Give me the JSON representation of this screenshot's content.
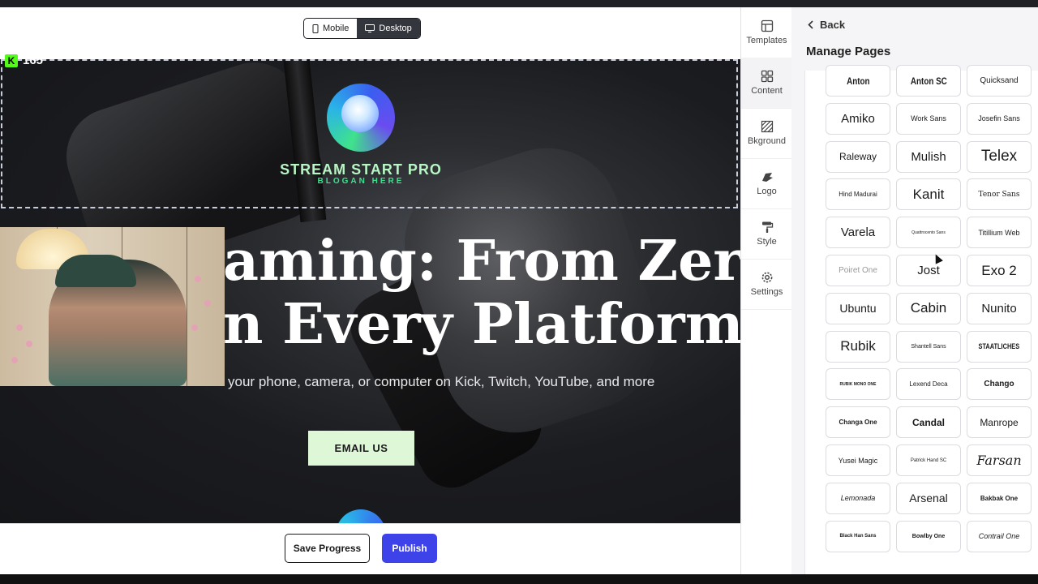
{
  "toolbar": {
    "mobile_label": "Mobile",
    "desktop_label": "Desktop"
  },
  "kick": {
    "count": "165"
  },
  "hero": {
    "brand": "STREAM START PRO",
    "slogan": "BLOGAN HERE",
    "title_line1": "aming: From Zero",
    "title_line2": "n Every Platform.",
    "subtitle": "Learn how to stream from your phone, camera, or computer on Kick, Twitch, YouTube, and more",
    "cta": "EMAIL US"
  },
  "actions": {
    "save": "Save Progress",
    "publish": "Publish"
  },
  "rail": {
    "items": [
      {
        "label": "Templates",
        "icon": "templates-icon"
      },
      {
        "label": "Content",
        "icon": "content-icon"
      },
      {
        "label": "Bkground",
        "icon": "background-icon"
      },
      {
        "label": "Logo",
        "icon": "logo-icon"
      },
      {
        "label": "Style",
        "icon": "style-icon"
      },
      {
        "label": "Settings",
        "icon": "settings-icon"
      }
    ]
  },
  "panel": {
    "back": "Back",
    "title": "Manage Pages"
  },
  "fonts": [
    "Anton",
    "Anton SC",
    "Quicksand",
    "Amiko",
    "Work Sans",
    "Josefin Sans",
    "Raleway",
    "Mulish",
    "Telex",
    "Hind Madurai",
    "Kanit",
    "Tenor Sans",
    "Varela",
    "Quattrocento Sans",
    "Titillium Web",
    "Poiret One",
    "Jost",
    "Exo 2",
    "Ubuntu",
    "Cabin",
    "Nunito",
    "Rubik",
    "Shantell Sans",
    "STAATLICHES",
    "RUBIK MONO ONE",
    "Lexend Deca",
    "Chango",
    "Changa One",
    "Candal",
    "Manrope",
    "Yusei Magic",
    "Patrick Hand SC",
    "Farsan",
    "Lemonada",
    "Arsenal",
    "Bakbak One",
    "Black Han Sans",
    "Bowlby One",
    "Contrail One"
  ],
  "colors": {
    "accent": "#3d43e8",
    "cta_bg": "#ddf7d7",
    "brand_green": "#3ee08e",
    "kick_green": "#53fc18"
  }
}
